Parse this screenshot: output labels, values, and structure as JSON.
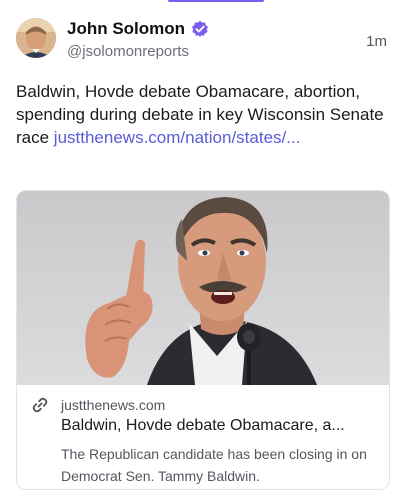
{
  "post": {
    "author_name": "John Solomon",
    "handle": "@jsolomonreports",
    "timestamp": "1m",
    "text": "Baldwin, Hovde debate Obamacare, abortion, spending during debate in key Wisconsin Senate race ",
    "link_text": "justthenews.com/nation/states/..."
  },
  "card": {
    "domain": "justthenews.com",
    "title": "Baldwin, Hovde debate Obamacare, a...",
    "description": "The Republican candidate has been closing in on Democrat Sen. Tammy Baldwin."
  },
  "icons": {
    "verified": "verified-badge-icon",
    "link": "link-icon"
  },
  "colors": {
    "accent": "#7d5cf0",
    "link": "#5b5bd6",
    "verified": "#7d5cf0"
  }
}
